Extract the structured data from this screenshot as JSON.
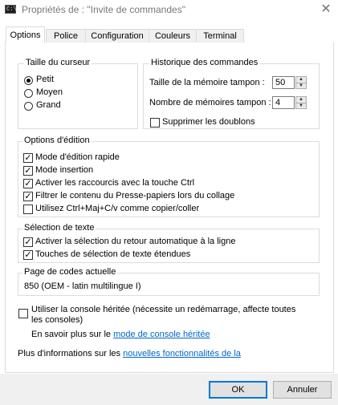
{
  "window": {
    "title": "Propriétés de : \"Invite de commandes\"",
    "icon_glyph": "C:\\_",
    "close_glyph": "✕"
  },
  "tabs": [
    {
      "label": "Options",
      "active": true
    },
    {
      "label": "Police",
      "active": false
    },
    {
      "label": "Configuration",
      "active": false
    },
    {
      "label": "Couleurs",
      "active": false
    },
    {
      "label": "Terminal",
      "active": false
    }
  ],
  "cursor_size": {
    "title": "Taille du curseur",
    "options": [
      {
        "label": "Petit",
        "selected": true
      },
      {
        "label": "Moyen",
        "selected": false
      },
      {
        "label": "Grand",
        "selected": false
      }
    ]
  },
  "history": {
    "title": "Historique des commandes",
    "buffer_size_label": "Taille de la mémoire tampon :",
    "buffer_size_value": "50",
    "buffer_count_label": "Nombre de mémoires tampon :",
    "buffer_count_value": "4",
    "discard_duplicates_label": "Supprimer les doublons",
    "discard_duplicates_checked": false
  },
  "edit_options": {
    "title": "Options d'édition",
    "items": [
      {
        "label": "Mode d'édition rapide",
        "checked": true
      },
      {
        "label": "Mode insertion",
        "checked": true
      },
      {
        "label": "Activer les raccourcis avec la touche Ctrl",
        "checked": true
      },
      {
        "label": "Filtrer le contenu du Presse-papiers lors du collage",
        "checked": true
      },
      {
        "label": "Utilisez Ctrl+Maj+C/v comme copier/coller",
        "checked": false
      }
    ]
  },
  "text_selection": {
    "title": "Sélection de texte",
    "items": [
      {
        "label": "Activer la sélection du retour automatique à la ligne",
        "checked": true
      },
      {
        "label": "Touches de sélection de texte étendues",
        "checked": true
      }
    ]
  },
  "codepage": {
    "title": "Page de codes actuelle",
    "value": "850   (OEM - latin multilingue I)"
  },
  "legacy": {
    "label_line1": "Utiliser la console héritée (nécessite un redémarrage, affecte toutes",
    "label_line2": "les consoles)",
    "checked": false,
    "learn_more_prefix": "En savoir plus sur le ",
    "learn_more_link": "mode de console héritée"
  },
  "more_info": {
    "prefix": "Plus d'informations sur les ",
    "link": "nouvelles fonctionnalités de la"
  },
  "buttons": {
    "ok": "OK",
    "cancel": "Annuler"
  },
  "check_glyph": "✓"
}
